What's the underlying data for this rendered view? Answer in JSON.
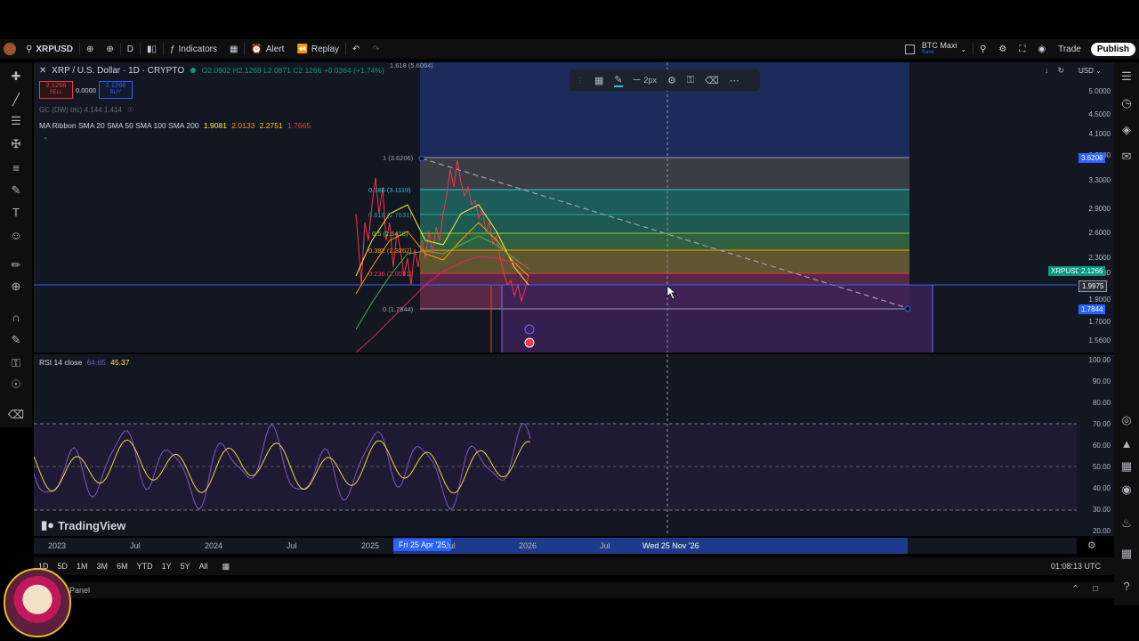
{
  "topbar": {
    "symbol": "XRPUSD",
    "interval": "D",
    "indicators_label": "Indicators",
    "alert_label": "Alert",
    "replay_label": "Replay",
    "layout_name": "BTC Maxi",
    "layout_status": "Save",
    "trade_label": "Trade",
    "publish_label": "Publish"
  },
  "legend": {
    "title": "XRP / U.S. Dollar · 1D · CRYPTO",
    "ohlc": "O2.0902 H2.1269 L2.0871 C2.1266 +0.0364 (+1.74%)",
    "sell_price": "2.1266",
    "sell_label": "SELL",
    "spread": "0.0000",
    "buy_price": "2.1266",
    "buy_label": "BUY",
    "gc_line": "GC (DW) btc) 4.144 1.414",
    "ma_label": "MA Ribbon SMA 20 SMA 50 SMA 100 SMA 200",
    "ma_v1": "1.9081",
    "ma_v2": "2.0133",
    "ma_v3": "2.2751",
    "ma_v4": "1.7665"
  },
  "drawing_toolbar": {
    "width_label": "2px"
  },
  "fib": {
    "top_label": "1 (3.6206)",
    "l0786": "0.786 (3.1119)",
    "l0618": "0.618 (2.7631)",
    "l05": "0.5 (2.5418)",
    "l0382": "0.382 (2.3262)",
    "l0236": "0.236 (2.0591)",
    "bottom_label": "0 (1.7844)",
    "ext_label": "1.618 (5.6064)"
  },
  "price_scale": {
    "currency": "USD",
    "ticks": [
      "5.0000",
      "4.5000",
      "4.1000",
      "3.7000",
      "3.3000",
      "2.9000",
      "2.6000",
      "2.3000",
      "2.1000",
      "1.9000",
      "1.7000",
      "1.5600"
    ],
    "fib_top_badge": "3.6206",
    "symbol_badge": "XRPUSD",
    "last_price": "2.1266",
    "crosshair_price": "1.9975",
    "fib_bottom_badge": "1.7844"
  },
  "rsi": {
    "label": "RSI 14 close",
    "v1": "64.65",
    "v2": "45.37",
    "ticks": [
      "100.00",
      "90.00",
      "80.00",
      "70.00",
      "60.00",
      "50.00",
      "40.00",
      "30.00",
      "20.00"
    ]
  },
  "time_axis": {
    "labels": [
      "2023",
      "Jul",
      "2024",
      "Jul",
      "2025",
      "Jul",
      "2026",
      "Jul"
    ],
    "range_start": "Fri 25 Apr '25",
    "crosshair_date": "Wed 25 Nov '26"
  },
  "watermark": "TradingView",
  "ranges": [
    "1D",
    "5D",
    "1M",
    "3M",
    "6M",
    "YTD",
    "1Y",
    "5Y",
    "All"
  ],
  "clock": "01:08:13 UTC",
  "panel_label": "Panel",
  "colors": {
    "bg": "#131722",
    "accent": "#2962ff",
    "down": "#f23645",
    "up": "#089981",
    "rsi_line": "#7e57c2"
  }
}
